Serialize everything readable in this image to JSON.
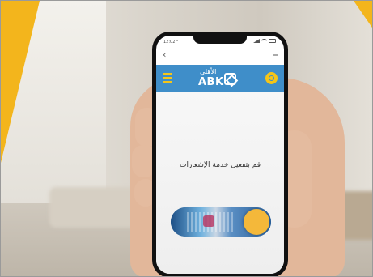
{
  "status_bar": {
    "time": "12:02 ⁸",
    "icons": [
      "signal-icon",
      "wifi-icon",
      "battery-icon"
    ]
  },
  "nav": {
    "back_icon": "‹"
  },
  "header": {
    "logo_arabic": "الأهلي",
    "logo_text": "ABK",
    "menu_icon": "hamburger-menu-icon",
    "coin_icon": "coin-icon"
  },
  "content": {
    "prompt": "قم بتفعيل خدمة الإشعارات"
  },
  "colors": {
    "accent": "#f3b51c",
    "header_blue": "#3f8ec9",
    "toggle_knob": "#f4b83a"
  }
}
